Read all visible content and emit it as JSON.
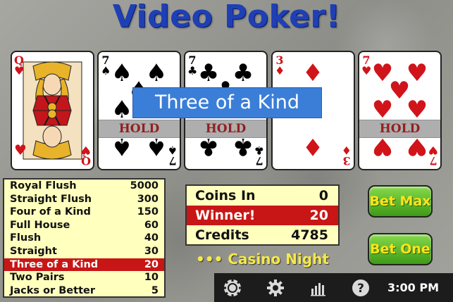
{
  "title": "Video Poker!",
  "cards": [
    {
      "rank": "Q",
      "suit": "hearts",
      "suit_glyph": "♥",
      "color": "#d0141a",
      "held": false
    },
    {
      "rank": "7",
      "suit": "spades",
      "suit_glyph": "♠",
      "color": "#000000",
      "held": true
    },
    {
      "rank": "7",
      "suit": "clubs",
      "suit_glyph": "♣",
      "color": "#000000",
      "held": true
    },
    {
      "rank": "3",
      "suit": "diamonds",
      "suit_glyph": "♦",
      "color": "#d0141a",
      "held": false
    },
    {
      "rank": "7",
      "suit": "hearts",
      "suit_glyph": "♥",
      "color": "#d0141a",
      "held": true
    }
  ],
  "hold_label": "HOLD",
  "result_banner": "Three of a Kind",
  "paytable": [
    {
      "hand": "Royal Flush",
      "pay": "5000",
      "active": false
    },
    {
      "hand": "Straight Flush",
      "pay": "300",
      "active": false
    },
    {
      "hand": "Four of a Kind",
      "pay": "150",
      "active": false
    },
    {
      "hand": "Full House",
      "pay": "60",
      "active": false
    },
    {
      "hand": "Flush",
      "pay": "40",
      "active": false
    },
    {
      "hand": "Straight",
      "pay": "30",
      "active": false
    },
    {
      "hand": "Three of a Kind",
      "pay": "20",
      "active": true
    },
    {
      "hand": "Two Pairs",
      "pay": "10",
      "active": false
    },
    {
      "hand": "Jacks or Better",
      "pay": "5",
      "active": false
    }
  ],
  "stats": {
    "coins_in_label": "Coins In",
    "coins_in_value": "0",
    "winner_label": "Winner!",
    "winner_value": "20",
    "credits_label": "Credits",
    "credits_value": "4785"
  },
  "casino_label": "••• Casino Night •••",
  "buttons": {
    "bet_max": "Bet Max",
    "bet_one": "Bet One"
  },
  "toolbar": {
    "icons": [
      "poker-chip-icon",
      "gear-icon",
      "bar-chart-icon",
      "help-icon"
    ],
    "time": "3:00 PM"
  },
  "colors": {
    "title": "#1f3fb5",
    "paytable_bg": "#ffffbe",
    "highlight": "#c81616",
    "button": "#4faa1e",
    "button_text": "#ffe41a",
    "banner": "#3a7ed8"
  }
}
